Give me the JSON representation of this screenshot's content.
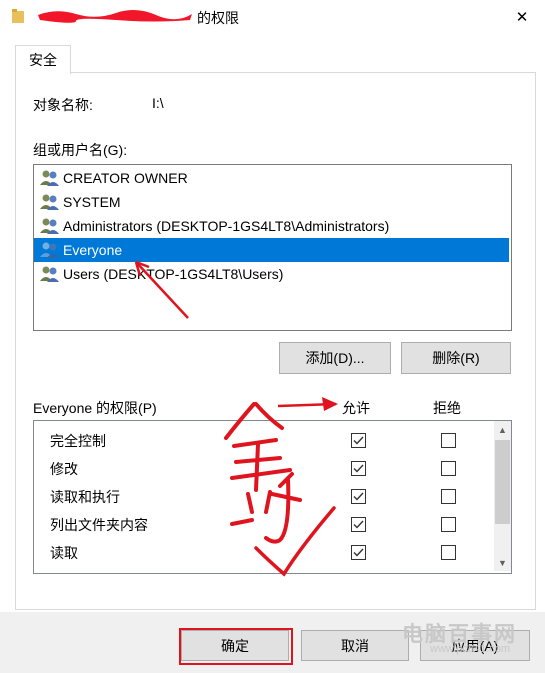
{
  "window": {
    "title_suffix": "的权限",
    "close_glyph": "✕"
  },
  "tabs": [
    {
      "label": "安全"
    }
  ],
  "object": {
    "label": "对象名称:",
    "value": "I:\\"
  },
  "groups": {
    "label": "组或用户名(G):",
    "items": [
      {
        "label": "CREATOR OWNER",
        "selected": false
      },
      {
        "label": "SYSTEM",
        "selected": false
      },
      {
        "label": "Administrators (DESKTOP-1GS4LT8\\Administrators)",
        "selected": false
      },
      {
        "label": "Everyone",
        "selected": true
      },
      {
        "label": "Users (DESKTOP-1GS4LT8\\Users)",
        "selected": false
      }
    ],
    "add_button": "添加(D)...",
    "remove_button": "删除(R)"
  },
  "permissions": {
    "label": "Everyone 的权限(P)",
    "allow_header": "允许",
    "deny_header": "拒绝",
    "rows": [
      {
        "name": "完全控制",
        "allow": true,
        "deny": false
      },
      {
        "name": "修改",
        "allow": true,
        "deny": false
      },
      {
        "name": "读取和执行",
        "allow": true,
        "deny": false
      },
      {
        "name": "列出文件夹内容",
        "allow": true,
        "deny": false
      },
      {
        "name": "读取",
        "allow": true,
        "deny": false
      }
    ]
  },
  "footer": {
    "ok_button": "确定",
    "cancel_button": "取消",
    "apply_button": "应用(A)"
  },
  "annotation": {
    "handwritten_text": "全打",
    "color": "#e0141e"
  },
  "watermark": {
    "text": "电脑百事网",
    "url": "www.pc841.com"
  },
  "colors": {
    "selection": "#0078d7",
    "annotation_red": "#e0141e",
    "button_face": "#e1e1e1"
  }
}
